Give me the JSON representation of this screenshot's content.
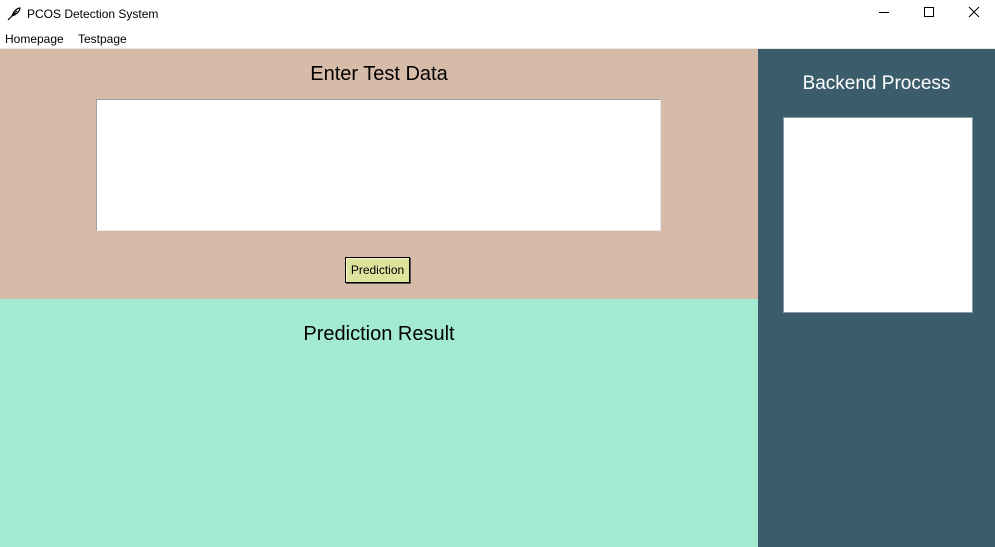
{
  "window": {
    "title": "PCOS Detection System",
    "icon": "feather-pen-icon",
    "controls": [
      "minimize-icon",
      "maximize-icon",
      "close-icon"
    ]
  },
  "menu": {
    "items": [
      {
        "label": "Homepage"
      },
      {
        "label": "Testpage"
      }
    ]
  },
  "input_panel": {
    "heading": "Enter Test Data",
    "input_value": "",
    "button_label": "Prediction",
    "background": "#d7bba9",
    "button_color": "#dde39c"
  },
  "result_panel": {
    "heading": "Prediction Result",
    "background": "#a2ead2"
  },
  "backend_panel": {
    "heading": "Backend Process",
    "background": "#3b5d6b"
  }
}
